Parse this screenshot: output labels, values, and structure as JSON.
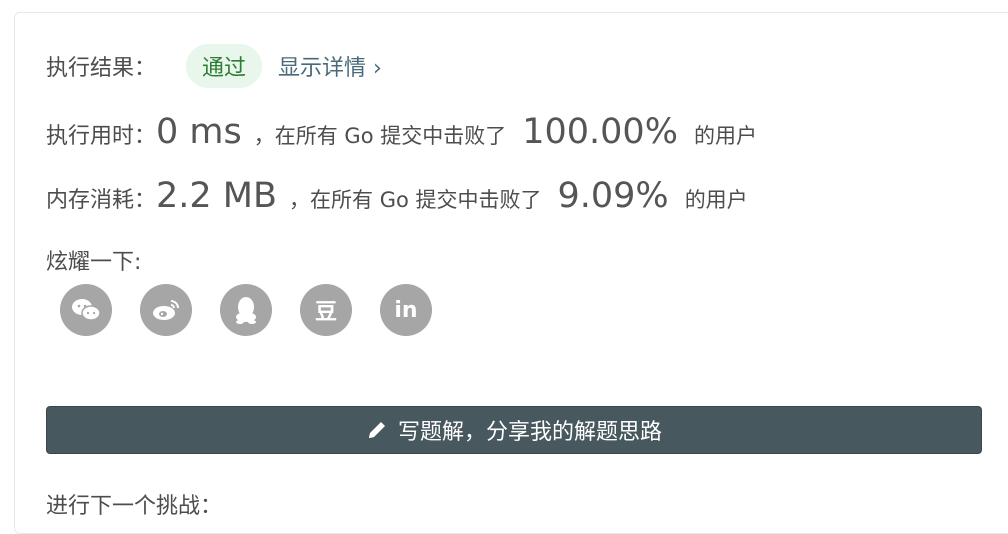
{
  "result": {
    "label": "执行结果：",
    "status": "通过",
    "details_link": "显示详情 ›"
  },
  "runtime": {
    "label": "执行用时：",
    "value": "0 ms",
    "beat_text": "，在所有 Go 提交中击败了",
    "percent": "100.00%",
    "suffix": "的用户"
  },
  "memory": {
    "label": "内存消耗：",
    "value": "2.2 MB",
    "beat_text": "，在所有 Go 提交中击败了",
    "percent": "9.09%",
    "suffix": "的用户"
  },
  "share": {
    "label": "炫耀一下:",
    "icons": [
      "wechat-icon",
      "weibo-icon",
      "qq-icon",
      "douban-icon",
      "linkedin-icon"
    ],
    "douban_glyph": "豆",
    "linkedin_glyph": "in"
  },
  "write_button": {
    "label": "写题解，分享我的解题思路"
  },
  "next_challenge": {
    "label": "进行下一个挑战："
  },
  "colors": {
    "pass_bg": "#e8f6ec",
    "pass_text": "#2f7d32",
    "icon_bg": "#a6a6a6",
    "button_bg": "#48585f"
  }
}
